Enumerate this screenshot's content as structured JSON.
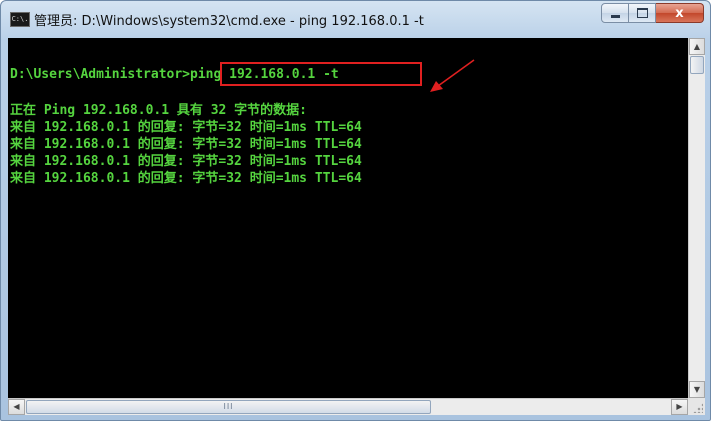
{
  "window": {
    "title": "管理员: D:\\Windows\\system32\\cmd.exe - ping  192.168.0.1 -t",
    "icon": "cmd-icon",
    "icon_text": "C:\\."
  },
  "caption_buttons": {
    "minimize": "minimize-icon",
    "maximize": "maximize-icon",
    "close_label": "x"
  },
  "console": {
    "prompt": "D:\\Users\\Administrator>",
    "command": "ping 192.168.0.1 -t",
    "output_header": "正在 Ping 192.168.0.1 具有 32 字节的数据:",
    "replies": [
      "来自 192.168.0.1 的回复: 字节=32 时间=1ms TTL=64",
      "来自 192.168.0.1 的回复: 字节=32 时间=1ms TTL=64",
      "来自 192.168.0.1 的回复: 字节=32 时间=1ms TTL=64",
      "来自 192.168.0.1 的回复: 字节=32 时间=1ms TTL=64"
    ],
    "text_color": "#55d43f",
    "background": "#000000"
  },
  "annotation": {
    "highlight_color": "#e02020"
  },
  "scrollbars": {
    "horizontal_thumb_grip": "III"
  }
}
